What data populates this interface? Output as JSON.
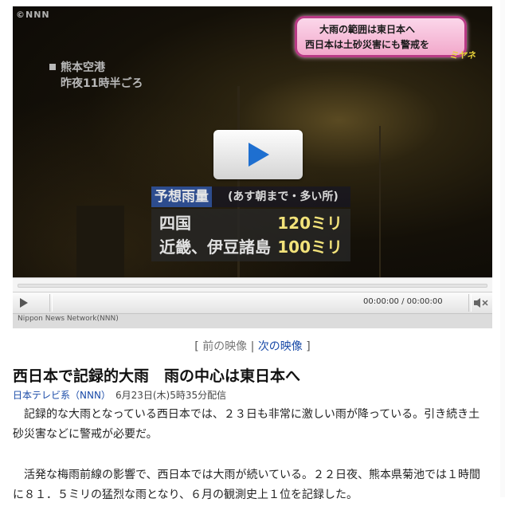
{
  "video": {
    "logo": "©NNN",
    "location_line1": "熊本空港",
    "location_line2": "昨夜11時半ごろ",
    "headline_line1": "大雨の範囲は東日本へ",
    "headline_line2": "西日本は土砂災害にも警戒を",
    "headline_tag": "ミヤネ",
    "forecast_title": "予想雨量",
    "forecast_note": "(あす朝まで・多い所)",
    "forecast_rows": [
      {
        "region": "四国",
        "amount": "120ミリ"
      },
      {
        "region": "近畿、伊豆諸島",
        "amount": "100ミリ"
      }
    ]
  },
  "player": {
    "time": "00:00:00 / 00:00:00",
    "credit": "Nippon News Network(NNN)",
    "progress": 0
  },
  "nav": {
    "open": "[",
    "prev": "前の映像",
    "divider": "|",
    "next": "次の映像",
    "close": "]"
  },
  "article": {
    "title": "西日本で記録的大雨　雨の中心は東日本へ",
    "source": "日本テレビ系（NNN）",
    "date": "6月23日(木)5時35分配信",
    "paragraphs": [
      "記録的な大雨となっている西日本では、２３日も非常に激しい雨が降っている。引き続き土砂災害などに警戒が必要だ。",
      "活発な梅雨前線の影響で、西日本では大雨が続いている。２２日夜、熊本県菊池では１時間に８１．５ミリの猛烈な雨となり、６月の観測史上１位を記録した。"
    ]
  },
  "colors": {
    "link": "#1a4ba8",
    "play": "#1e6fd0",
    "headline_border": "#b83a85"
  }
}
